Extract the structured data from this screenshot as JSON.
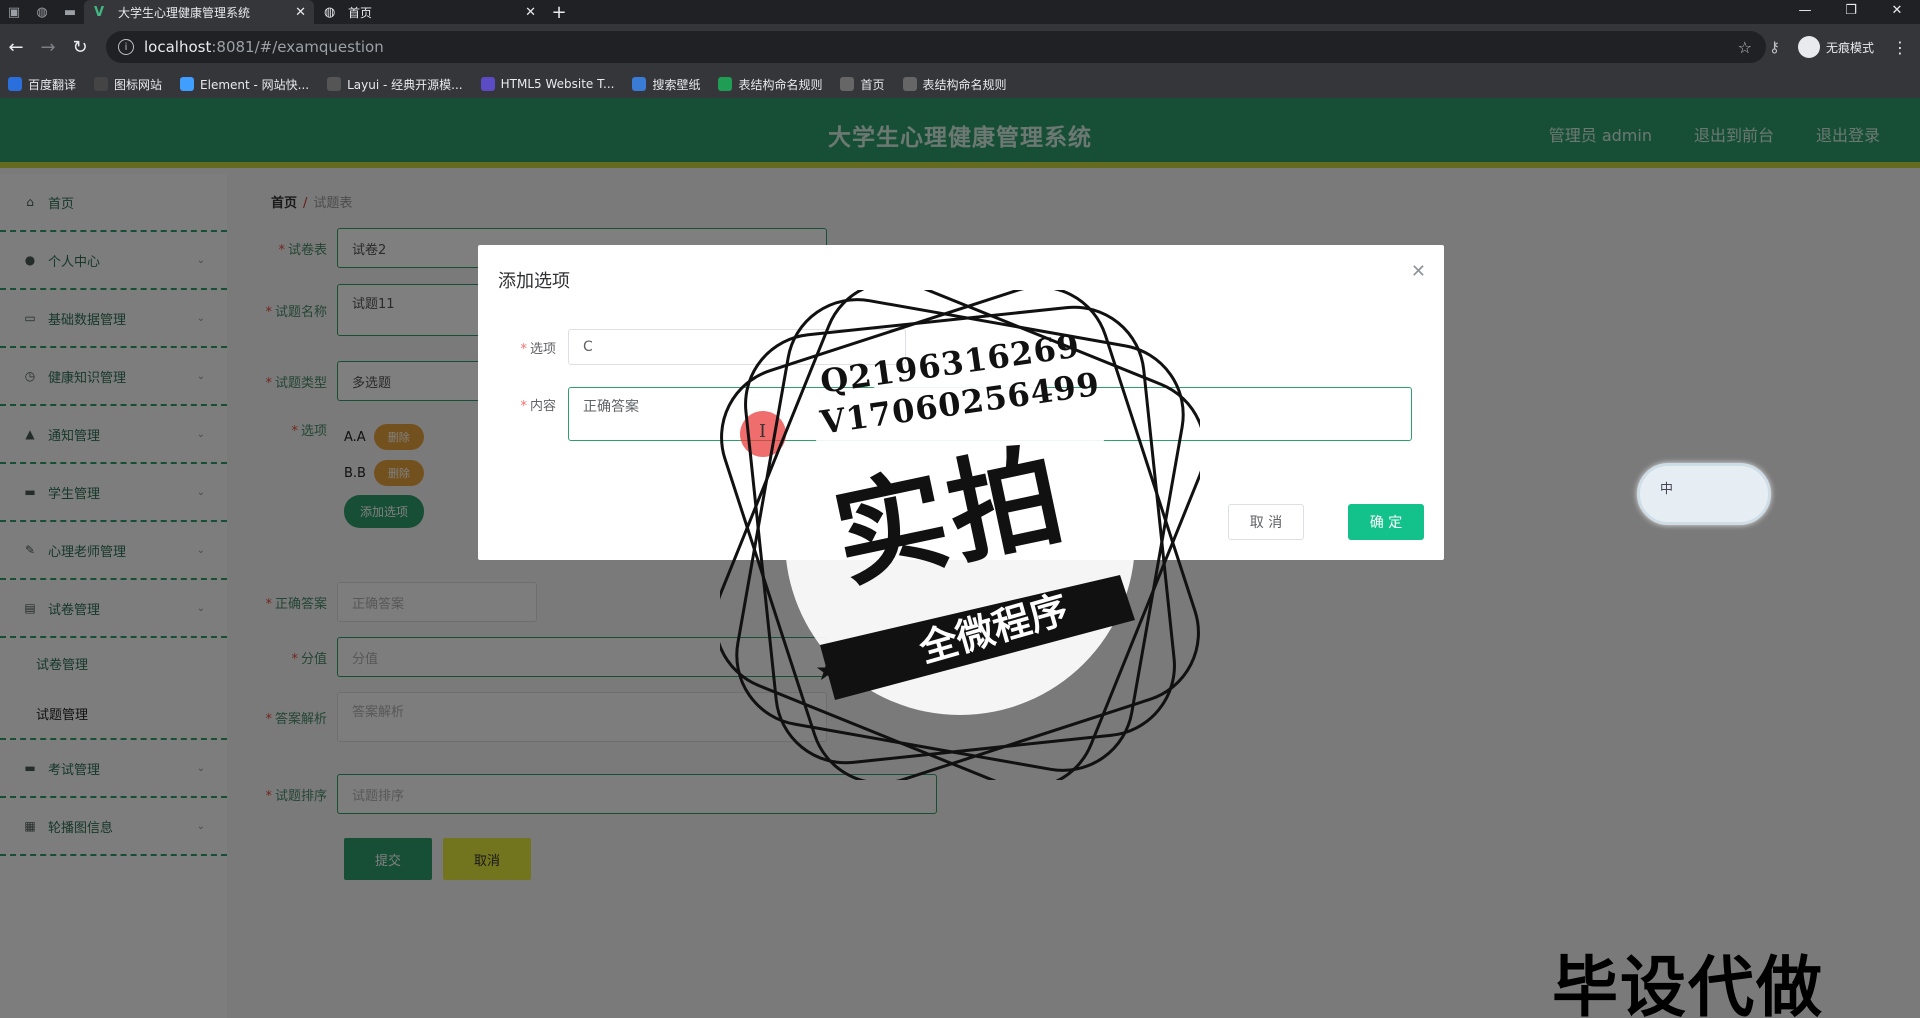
{
  "browser": {
    "tabs": [
      {
        "title": "大学生心理健康管理系统",
        "active": true
      },
      {
        "title": "首页",
        "active": false
      }
    ],
    "url_host": "localhost",
    "url_path": ":8081/#/examquestion",
    "incognito_label": "无痕模式",
    "bookmarks": [
      {
        "label": "百度翻译",
        "color": "#2a6fdb"
      },
      {
        "label": "图标网站",
        "color": "#444"
      },
      {
        "label": "Element - 网站快...",
        "color": "#409eff"
      },
      {
        "label": "Layui - 经典开源模...",
        "color": "#555"
      },
      {
        "label": "HTML5 Website T...",
        "color": "#5b4bc4"
      },
      {
        "label": "搜索壁纸",
        "color": "#3a7bd5"
      },
      {
        "label": "表结构命名规则",
        "color": "#1f9d55"
      },
      {
        "label": "首页",
        "color": "#666"
      },
      {
        "label": "表结构命名规则",
        "color": "#666"
      }
    ]
  },
  "header": {
    "title": "大学生心理健康管理系统",
    "admin": "管理员 admin",
    "to_front": "退出到前台",
    "logout": "退出登录"
  },
  "sidebar": {
    "items": [
      {
        "label": "首页",
        "icon": "home-icon"
      },
      {
        "label": "个人中心",
        "icon": "user-icon",
        "arrow": true
      },
      {
        "label": "基础数据管理",
        "icon": "chat-icon",
        "arrow": true
      },
      {
        "label": "健康知识管理",
        "icon": "clock-icon",
        "arrow": true
      },
      {
        "label": "通知管理",
        "icon": "bell-icon",
        "arrow": true
      },
      {
        "label": "学生管理",
        "icon": "monitor-icon",
        "arrow": true
      },
      {
        "label": "心理老师管理",
        "icon": "edit-icon",
        "arrow": true
      },
      {
        "label": "试卷管理",
        "icon": "doc-icon",
        "arrow": true
      }
    ],
    "subitems": [
      "试卷管理",
      "试题管理"
    ],
    "items_after": [
      {
        "label": "考试管理",
        "icon": "monitor-icon",
        "arrow": true
      },
      {
        "label": "轮播图信息",
        "icon": "grid-icon",
        "arrow": true
      }
    ]
  },
  "breadcrumb": {
    "home": "首页",
    "current": "试题表"
  },
  "form": {
    "paper_label": "试卷表",
    "paper_value": "试卷2",
    "name_label": "试题名称",
    "name_value": "试题11",
    "type_label": "试题类型",
    "type_value": "多选题",
    "options_label": "选项",
    "option_a": "A.A",
    "option_b": "B.B",
    "delete_label": "删除",
    "add_option": "添加选项",
    "answer_label": "正确答案",
    "answer_placeholder": "正确答案",
    "score_label": "分值",
    "score_placeholder": "分值",
    "analysis_label": "答案解析",
    "analysis_placeholder": "答案解析",
    "sort_label": "试题排序",
    "sort_placeholder": "试题排序",
    "submit": "提交",
    "cancel": "取消"
  },
  "dialog": {
    "title": "添加选项",
    "option_label": "选项",
    "option_value": "C",
    "content_label": "内容",
    "content_value": "正确答案",
    "cancel": "取 消",
    "ok": "确 定"
  },
  "ime": {
    "label": "中"
  },
  "watermark": {
    "line1": "Q2196316269",
    "line2": "V17060256499",
    "big": "实拍",
    "banner": "全微程序",
    "corner": "毕设代做"
  }
}
